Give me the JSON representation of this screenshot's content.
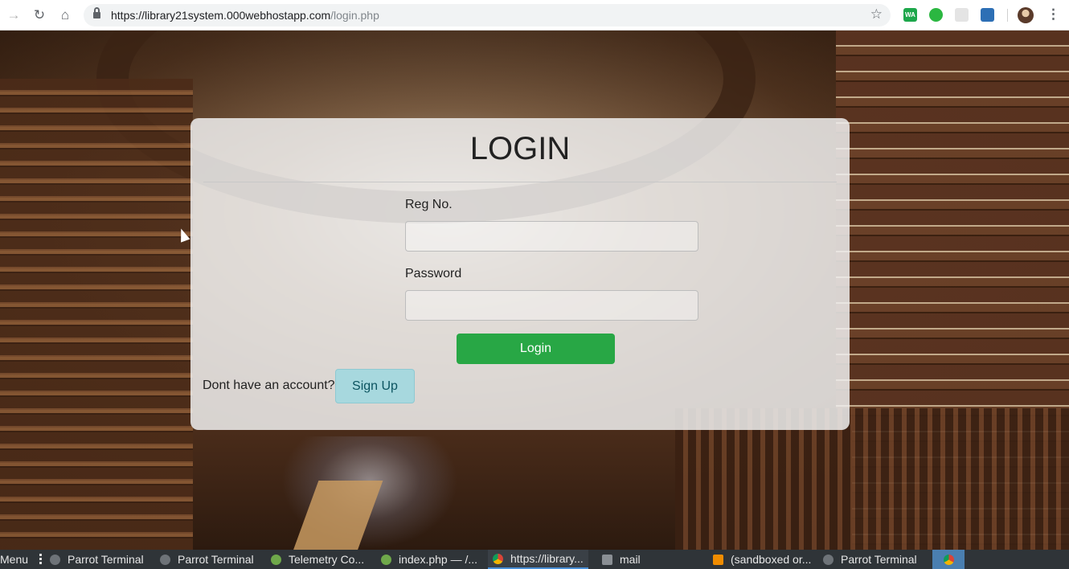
{
  "browser": {
    "url_host": "https://library21system.000webhostapp.com",
    "url_path": "/login.php",
    "extensions": [
      "whatsapp-web-extension-icon",
      "whatsapp-extension-icon",
      "grid-extension-icon",
      "briefcase-extension-icon"
    ]
  },
  "login_card": {
    "title": "LOGIN",
    "reg_label": "Reg No.",
    "reg_value": "",
    "password_label": "Password",
    "password_value": "",
    "login_button": "Login",
    "no_account_text": "Dont have an account?",
    "signup_button": "Sign Up",
    "colors": {
      "login_button": "#28a745",
      "signup_button": "#a7d8de"
    }
  },
  "taskbar": {
    "menu_label": "Menu",
    "items": [
      {
        "label": "Parrot Terminal",
        "icon": "terminal-icon"
      },
      {
        "label": "Parrot Terminal",
        "icon": "terminal-icon"
      },
      {
        "label": "Telemetry Co...",
        "icon": "globe-icon"
      },
      {
        "label": "index.php — /...",
        "icon": "globe-icon"
      },
      {
        "label": "https://library...",
        "icon": "chrome-icon",
        "active": true
      },
      {
        "label": "mail",
        "icon": "folder-icon"
      },
      {
        "label": "(sandboxed or...",
        "icon": "vlc-icon"
      },
      {
        "label": "Parrot Terminal",
        "icon": "terminal-icon"
      }
    ]
  }
}
